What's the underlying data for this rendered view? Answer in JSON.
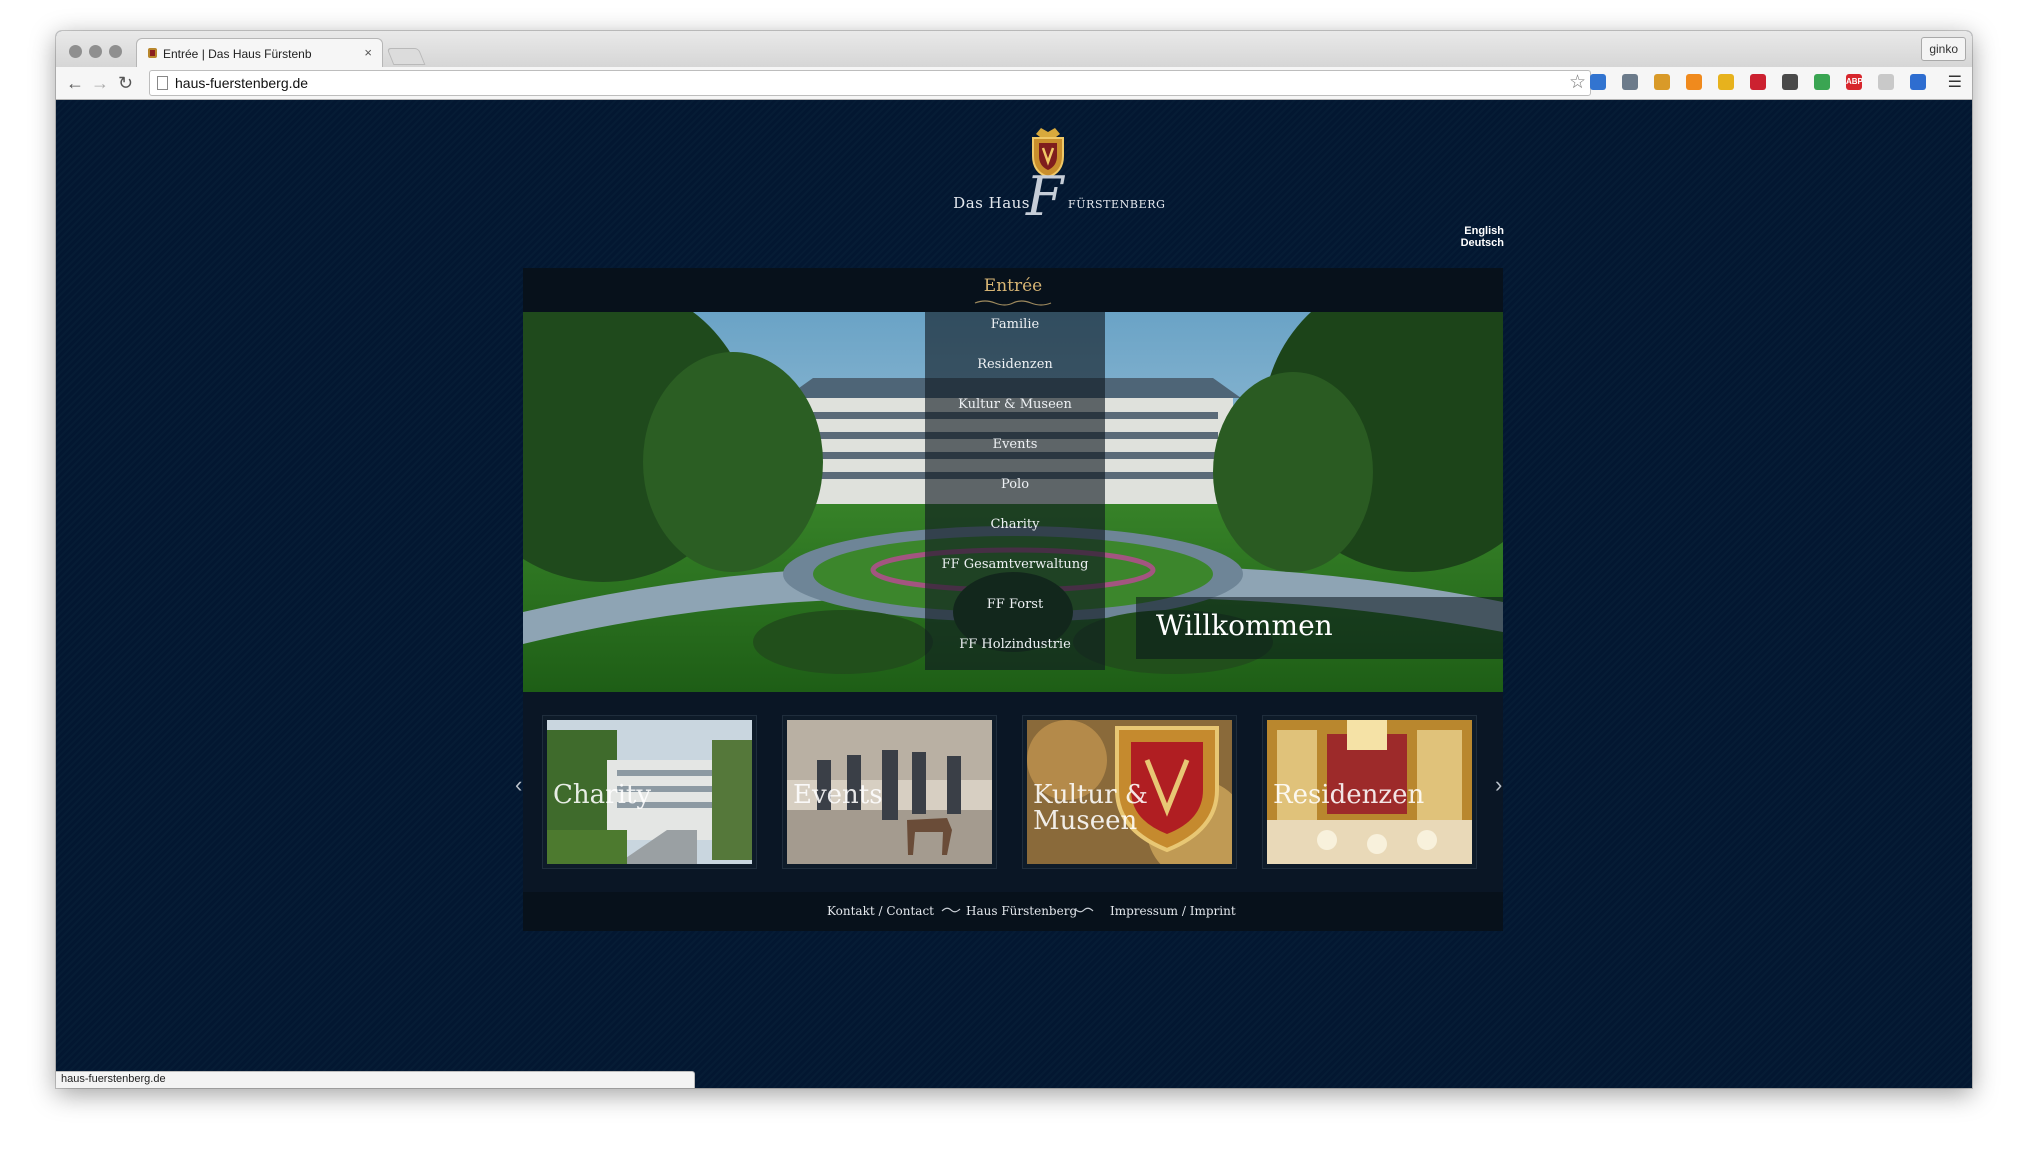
{
  "browser": {
    "tab_title": "Entrée | Das Haus Fürstenb",
    "tab_close": "×",
    "url": "haus-fuerstenberg.de",
    "profile": "ginko",
    "status_url": "haus-fuerstenberg.de"
  },
  "extensions": [
    {
      "icon": "delicious-icon",
      "color": "#3274d0",
      "text": ""
    },
    {
      "icon": "eyedropper-icon",
      "color": "#6c7b8b",
      "text": ""
    },
    {
      "icon": "bookmark-folder-icon",
      "color": "#d99a28",
      "text": ""
    },
    {
      "icon": "chart-icon",
      "color": "#f08a1d",
      "text": ""
    },
    {
      "icon": "plug-icon",
      "color": "#e7b21d",
      "text": ""
    },
    {
      "icon": "grid-icon",
      "color": "#cc2130",
      "text": ""
    },
    {
      "icon": "star-ext-icon",
      "color": "#4a4a4a",
      "text": ""
    },
    {
      "icon": "layers-icon",
      "color": "#3aa552",
      "text": ""
    },
    {
      "icon": "adblock-icon",
      "color": "#d7262c",
      "text": "ABP"
    },
    {
      "icon": "cloud-icon",
      "color": "#c9c9c9",
      "text": ""
    },
    {
      "icon": "delicious-2-icon",
      "color": "#2e6dd0",
      "text": ""
    }
  ],
  "site": {
    "logo_left": "Das Haus",
    "logo_mark": "F",
    "logo_right": "Fürstenberg",
    "lang_english": "English",
    "lang_deutsch": "Deutsch",
    "nav_title": "Entrée",
    "menu": [
      "Familie",
      "Residenzen",
      "Kultur & Museen",
      "Events",
      "Polo",
      "Charity",
      "FF Gesamtverwaltung",
      "FF Forst",
      "FF Holzindustrie"
    ],
    "hero_caption": "Willkommen",
    "tiles": [
      {
        "label_line1": "Charity",
        "label_line2": ""
      },
      {
        "label_line1": "Events",
        "label_line2": ""
      },
      {
        "label_line1": "Kultur &",
        "label_line2": "Museen"
      },
      {
        "label_line1": "Residenzen",
        "label_line2": ""
      }
    ],
    "prev_arrow": "‹",
    "next_arrow": "›",
    "footer": {
      "contact": "Kontakt / Contact",
      "center": "Haus Fürstenberg",
      "imprint": "Impressum / Imprint"
    }
  },
  "colors": {
    "page_background": "#02172f",
    "accent_gold": "#d7b574",
    "menu_text": "#eef1f4"
  }
}
